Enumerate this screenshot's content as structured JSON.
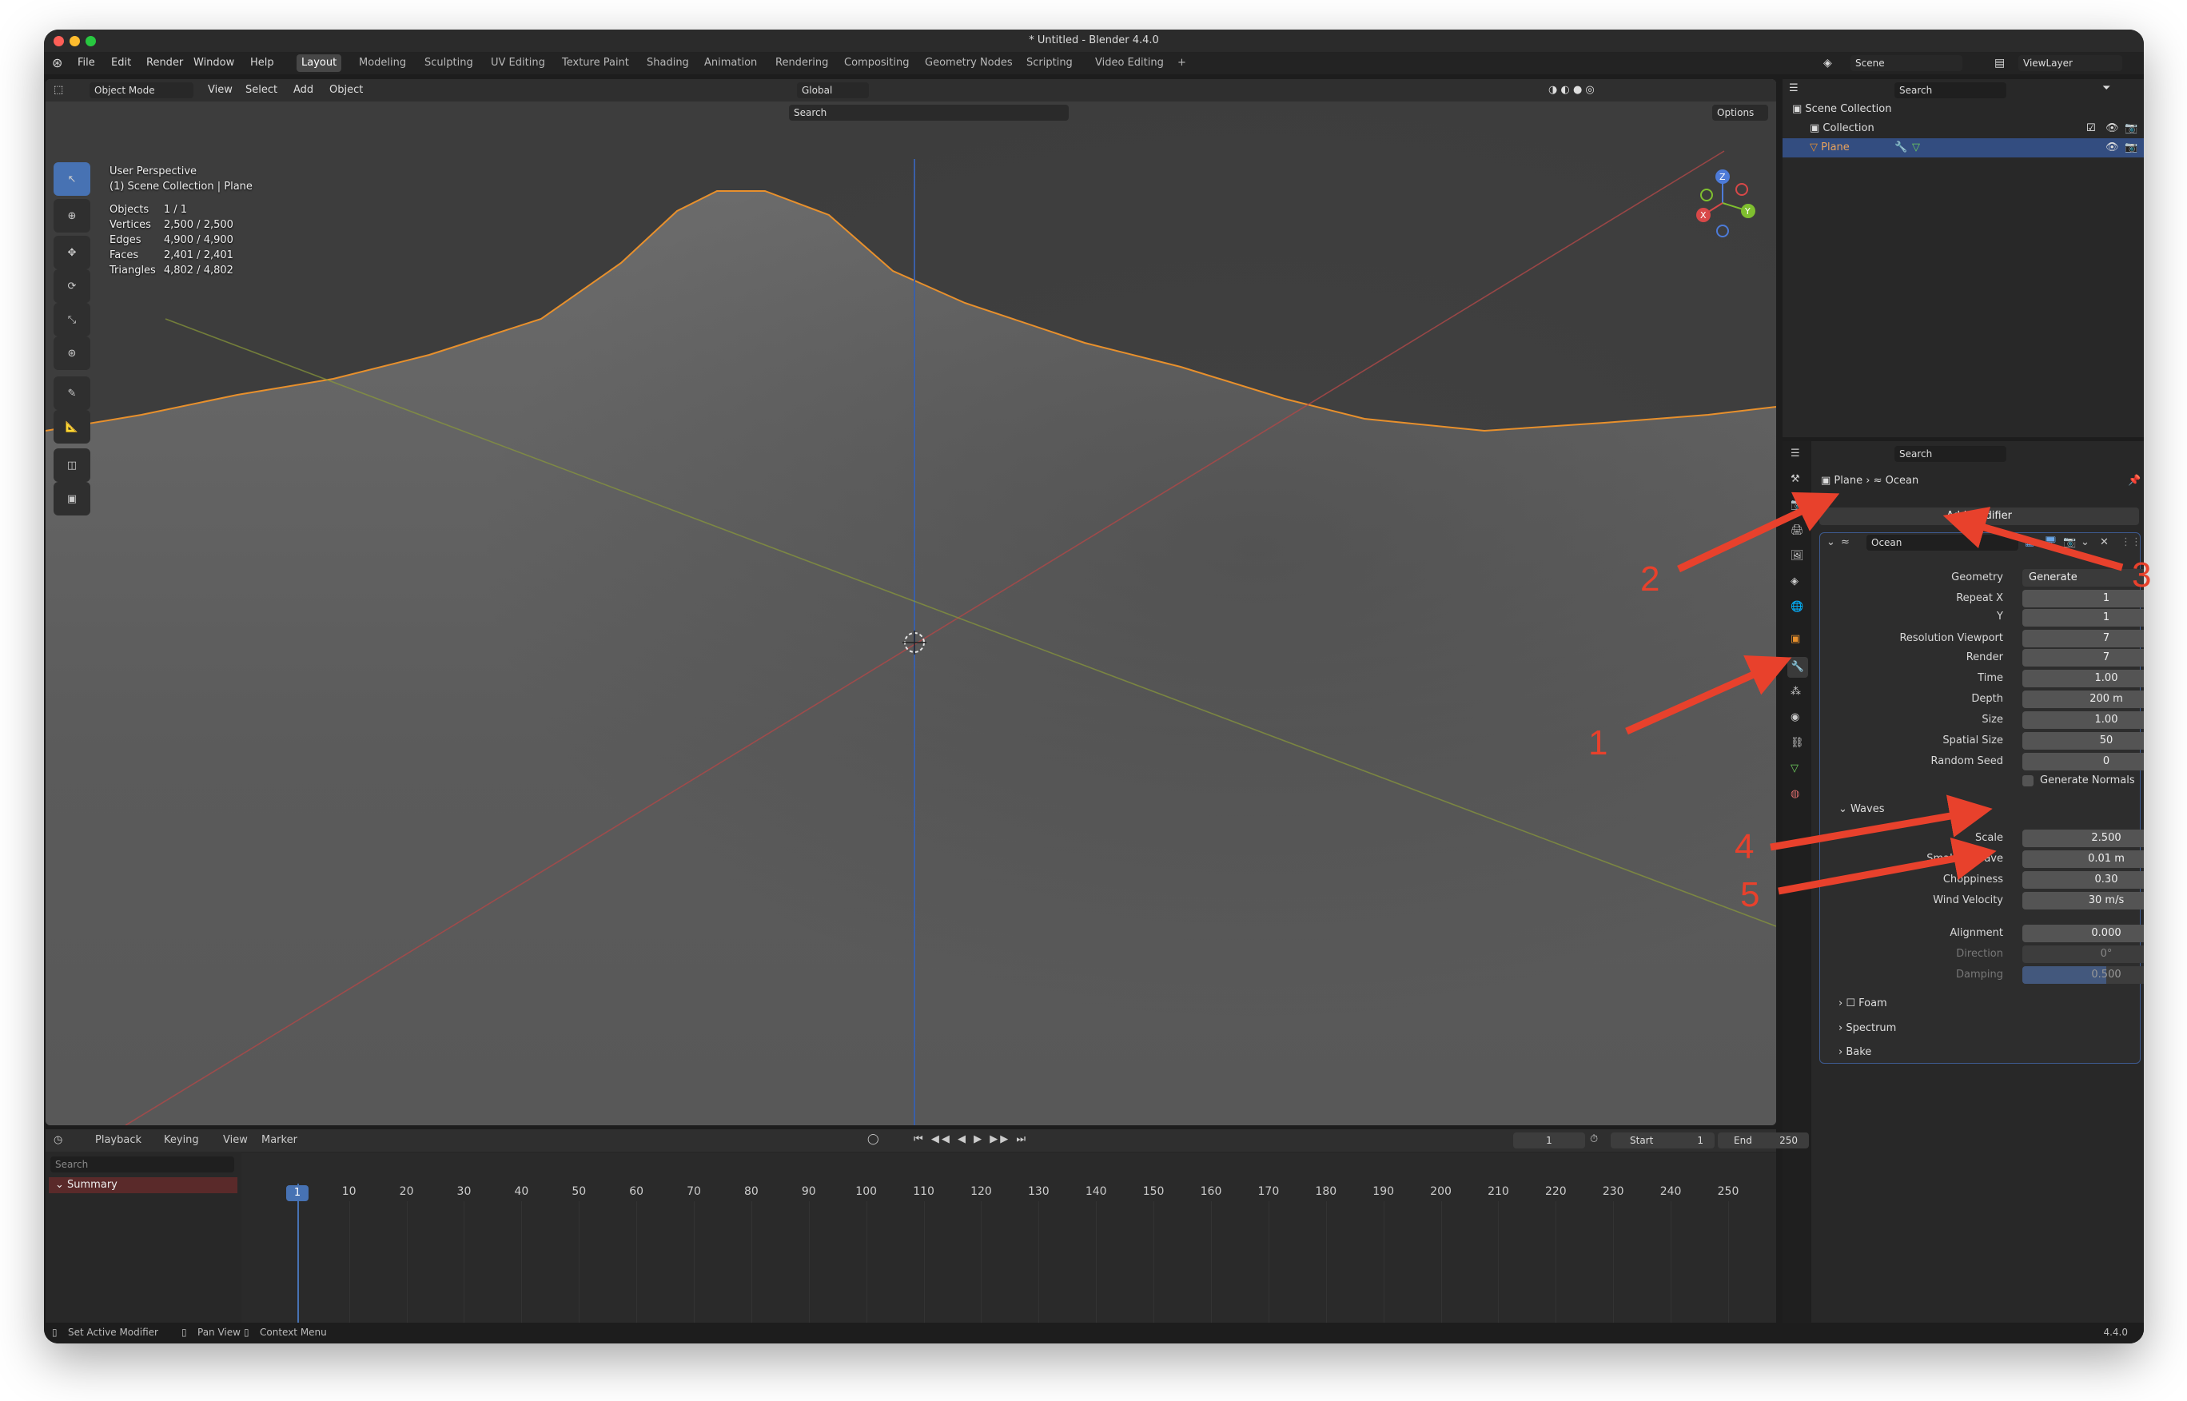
{
  "window": {
    "title": "* Untitled - Blender 4.4.0"
  },
  "menu": [
    "File",
    "Edit",
    "Render",
    "Window",
    "Help"
  ],
  "workspaces": [
    "Layout",
    "Modeling",
    "Sculpting",
    "UV Editing",
    "Texture Paint",
    "Shading",
    "Animation",
    "Rendering",
    "Compositing",
    "Geometry Nodes",
    "Scripting",
    "Video Editing",
    "+"
  ],
  "scene": {
    "label": "Scene",
    "view_layer": "ViewLayer"
  },
  "viewport": {
    "mode": "Object Mode",
    "menus": [
      "View",
      "Select",
      "Add",
      "Object"
    ],
    "transform": "Global",
    "search_placeholder": "Search",
    "options": "Options",
    "overlay": {
      "line1": "User Perspective",
      "line2": "(1) Scene Collection | Plane"
    },
    "stats": [
      {
        "k": "Objects",
        "v": "1 / 1"
      },
      {
        "k": "Vertices",
        "v": "2,500 / 2,500"
      },
      {
        "k": "Edges",
        "v": "4,900 / 4,900"
      },
      {
        "k": "Faces",
        "v": "2,401 / 2,401"
      },
      {
        "k": "Triangles",
        "v": "4,802 / 4,802"
      }
    ],
    "gizmo": {
      "z": "Z",
      "y": "Y",
      "x": "X"
    }
  },
  "outliner": {
    "search_placeholder": "Search",
    "items": [
      "Scene Collection",
      "Collection",
      "Plane"
    ]
  },
  "properties": {
    "search_placeholder": "Search",
    "breadcrumb": {
      "object": "Plane",
      "modifier": "Ocean"
    },
    "add_modifier": "Add Modifier",
    "modifier_name": "Ocean",
    "fields": [
      {
        "label": "Geometry",
        "value": "Generate"
      },
      {
        "label": "Repeat X",
        "value": "1"
      },
      {
        "label": "Y",
        "value": "1"
      },
      {
        "label": "Resolution Viewport",
        "value": "7"
      },
      {
        "label": "Render",
        "value": "7"
      },
      {
        "label": "Time",
        "value": "1.00"
      },
      {
        "label": "Depth",
        "value": "200 m"
      },
      {
        "label": "Size",
        "value": "1.00"
      },
      {
        "label": "Spatial Size",
        "value": "50"
      },
      {
        "label": "Random Seed",
        "value": "0"
      }
    ],
    "generate_normals": "Generate Normals",
    "waves_section": "Waves",
    "waves": [
      {
        "label": "Scale",
        "value": "2.500"
      },
      {
        "label": "Smallest Wave",
        "value": "0.01 m"
      },
      {
        "label": "Choppiness",
        "value": "0.30"
      },
      {
        "label": "Wind Velocity",
        "value": "30 m/s"
      }
    ],
    "alignment": {
      "label": "Alignment",
      "value": "0.000"
    },
    "direction": {
      "label": "Direction",
      "value": "0°"
    },
    "damping": {
      "label": "Damping",
      "value": "0.500",
      "fill": 0.5
    },
    "collapsed": [
      "Foam",
      "Spectrum",
      "Bake"
    ]
  },
  "timeline": {
    "menus": [
      "Playback",
      "Keying",
      "View",
      "Marker"
    ],
    "current_frame": "1",
    "start_label": "Start",
    "start": "1",
    "end_label": "End",
    "end": "250",
    "search_placeholder": "Search",
    "summary": "Summary",
    "ticks": [
      "1",
      "10",
      "20",
      "30",
      "40",
      "50",
      "60",
      "70",
      "80",
      "90",
      "100",
      "110",
      "120",
      "130",
      "140",
      "150",
      "160",
      "170",
      "180",
      "190",
      "200",
      "210",
      "220",
      "230",
      "240",
      "250"
    ]
  },
  "status": {
    "items": [
      "Set Active Modifier",
      "Pan View",
      "Context Menu"
    ],
    "version": "4.4.0"
  },
  "annotations": [
    "1",
    "2",
    "3",
    "4",
    "5"
  ],
  "colors": {
    "accent": "#4772b3",
    "selection_outline": "#e8902c",
    "arrow": "#e8412c"
  }
}
